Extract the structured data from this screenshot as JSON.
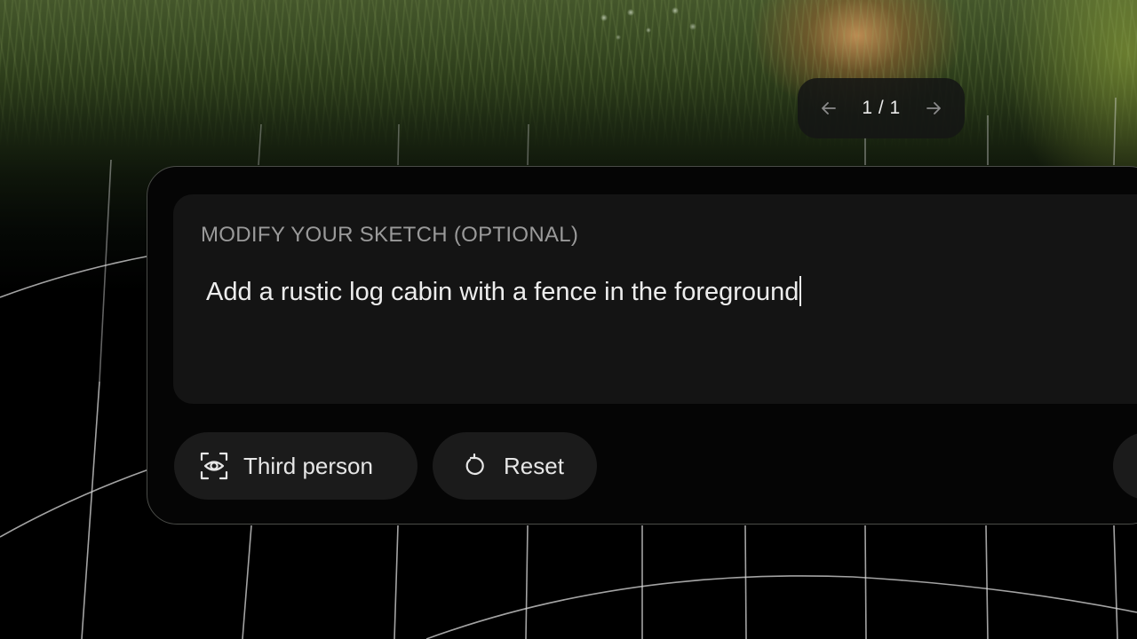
{
  "pager": {
    "prev_icon": "arrow-left-icon",
    "counter": "1 / 1",
    "next_icon": "arrow-right-icon"
  },
  "prompt": {
    "label": "MODIFY YOUR SKETCH (OPTIONAL)",
    "value": "Add a rustic log cabin with a fence in the foreground"
  },
  "actions": {
    "third_person": {
      "label": "Third person",
      "icon": "camera-view-icon"
    },
    "reset": {
      "label": "Reset",
      "icon": "reset-icon"
    }
  },
  "colors": {
    "panel_bg": "#050505",
    "input_bg": "#141414",
    "pill_bg": "#1b1b1b",
    "label_text": "#9a9a9a",
    "text": "#ededed"
  }
}
